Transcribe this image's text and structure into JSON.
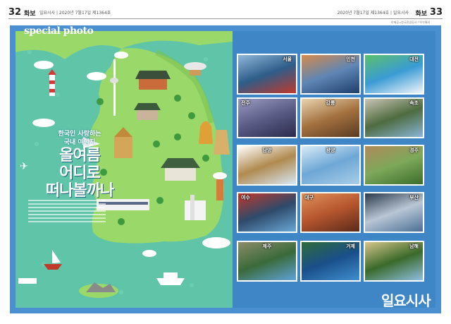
{
  "header": {
    "left_page": "32",
    "left_section": "화보",
    "left_pub": "일요시사 | 2020년 7월17일 제1364호",
    "right_page": "33",
    "right_section": "화보",
    "right_pub": "2020년 7월17일 제1364호 | 일요시사",
    "credit": "©제공=한국관광공사 / 박식해외"
  },
  "feature": {
    "tag": "special photo",
    "sub_line1": "한국인 사랑하는",
    "sub_line2": "국내 여행지",
    "title_line1": "올여름",
    "title_line2": "어디로",
    "title_line3": "떠나볼까나"
  },
  "photos": [
    {
      "label": "서울",
      "colors": [
        "#c0392b",
        "#2e5d8a",
        "#8fb7d8"
      ]
    },
    {
      "label": "인천",
      "colors": [
        "#1e3d6b",
        "#5f86b5",
        "#d68a4a"
      ]
    },
    {
      "label": "대전",
      "colors": [
        "#f3f6fa",
        "#3a9bd5",
        "#5bc06b"
      ]
    },
    {
      "label": "전주",
      "colors": [
        "#2a2a4a",
        "#5a5c86",
        "#9b9bc0"
      ]
    },
    {
      "label": "강릉",
      "colors": [
        "#5a3a22",
        "#a3713f",
        "#e8d4b0"
      ]
    },
    {
      "label": "속초",
      "colors": [
        "#8ab4d8",
        "#4e6b3f",
        "#c9c4b5"
      ]
    },
    {
      "label": "담양",
      "colors": [
        "#d8e8f5",
        "#b08a4f",
        "#ffffff"
      ]
    },
    {
      "label": "광양",
      "colors": [
        "#a8cde8",
        "#6ea7d6",
        "#d8eaf6"
      ]
    },
    {
      "label": "경주",
      "colors": [
        "#3b6d2b",
        "#7da85a",
        "#b08a5a"
      ]
    },
    {
      "label": "여수",
      "colors": [
        "#6aa7d6",
        "#2e4a6a",
        "#c0392b"
      ]
    },
    {
      "label": "대구",
      "colors": [
        "#5a2a1a",
        "#b5552e",
        "#e0905a"
      ]
    },
    {
      "label": "부산",
      "colors": [
        "#4b6f95",
        "#b9c6d5",
        "#2a3a4a"
      ]
    },
    {
      "label": "제주",
      "colors": [
        "#5fa2d8",
        "#3a6a3a",
        "#8c8c6a"
      ]
    },
    {
      "label": "거제",
      "colors": [
        "#3f8fcf",
        "#1a4f8a",
        "#2f6b3a"
      ]
    },
    {
      "label": "남해",
      "colors": [
        "#8fbfe0",
        "#3a6a2a",
        "#d6c48a"
      ]
    }
  ],
  "logo": "일요시사",
  "colors": {
    "frame": "#4a8fd0",
    "map_bg": "#5fc4a8",
    "land": "#9bd86a",
    "right_bg": "#3f86c7"
  }
}
